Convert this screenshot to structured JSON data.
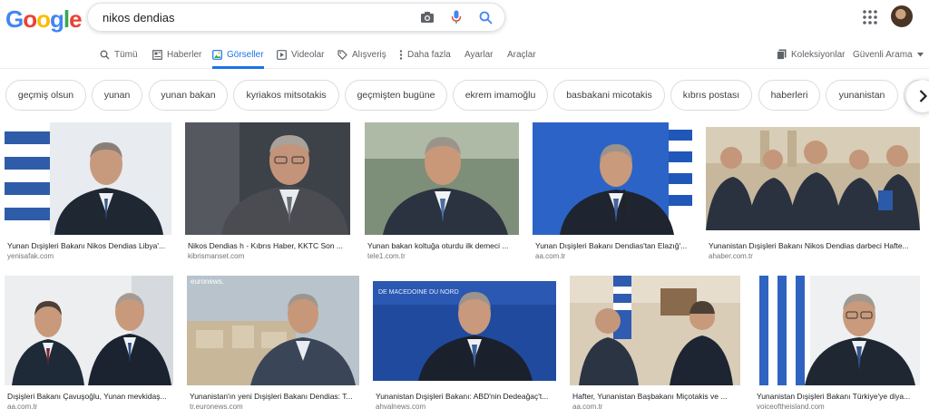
{
  "logo": {
    "letters": [
      "G",
      "o",
      "o",
      "g",
      "l",
      "e"
    ],
    "colors": [
      "#4285F4",
      "#EA4335",
      "#FBBC05",
      "#4285F4",
      "#34A853",
      "#EA4335"
    ]
  },
  "search": {
    "query": "nikos dendias",
    "icons": [
      "camera-icon",
      "microphone-icon",
      "search-icon"
    ]
  },
  "header": {
    "apps_icon": "apps-grid-icon",
    "avatar": "account-avatar"
  },
  "tabs": [
    {
      "label": "Tümü",
      "icon": "search-icon"
    },
    {
      "label": "Haberler",
      "icon": "news-icon"
    },
    {
      "label": "Görseller",
      "icon": "image-icon",
      "active": true
    },
    {
      "label": "Videolar",
      "icon": "play-icon"
    },
    {
      "label": "Alışveriş",
      "icon": "tag-icon"
    },
    {
      "label": "Daha fazla",
      "icon": "more-vert-icon"
    },
    {
      "label": "Ayarlar"
    },
    {
      "label": "Araçlar"
    }
  ],
  "right_tools": {
    "collections": "Koleksiyonlar",
    "safe_search": "Güvenli Arama"
  },
  "chips": [
    "geçmiş olsun",
    "yunan",
    "yunan bakan",
    "kyriakos mitsotakis",
    "geçmişten bugüne",
    "ekrem imamoğlu",
    "basbakani micotakis",
    "kıbrıs postası",
    "haberleri",
    "yunanistan"
  ],
  "results": [
    {
      "caption": "Yunan Dışişleri Bakanı Nikos Dendias Libya'...",
      "domain": "yenisafak.com"
    },
    {
      "caption": "Nikos Dendias h - Kıbrıs Haber, KKTC Son ...",
      "domain": "kibrismanset.com"
    },
    {
      "caption": "Yunan bakan koltuğa oturdu ilk demeci ...",
      "domain": "tele1.com.tr"
    },
    {
      "caption": "Yunan Dışişleri Bakanı Dendias'tan Elazığ'...",
      "domain": "aa.com.tr"
    },
    {
      "caption": "Yunanistan Dışişleri Bakanı Nikos Dendias darbeci Hafte...",
      "domain": "ahaber.com.tr"
    },
    {
      "caption": "Dışişleri Bakanı Çavuşoğlu, Yunan mevkidaş...",
      "domain": "aa.com.tr"
    },
    {
      "caption": "Yunanistan'ın yeni Dışişleri Bakanı Dendias: T...",
      "domain": "tr.euronews.com",
      "overlay": "euronews."
    },
    {
      "caption": "Yunanistan Dışişleri Bakanı: ABD'nin Dedeağaç't...",
      "domain": "ahvalnews.com",
      "overlay": "DE MACEDOINE DU NORD"
    },
    {
      "caption": "Hafter, Yunanistan Başbakanı Miçotakis ve ...",
      "domain": "aa.com.tr"
    },
    {
      "caption": "Yunanistan Dışişleri Bakanı Türkiye'ye diya...",
      "domain": "voiceoftheisland.com"
    }
  ],
  "colors": {
    "accent": "#1a73e8",
    "text": "#202124",
    "muted": "#70757a"
  }
}
